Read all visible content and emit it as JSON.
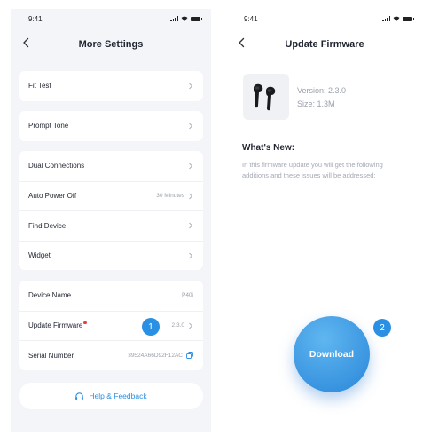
{
  "left": {
    "status_time": "9:41",
    "title": "More Settings",
    "cards": [
      {
        "rows": [
          {
            "label": "Fit Test",
            "value": ""
          }
        ]
      },
      {
        "rows": [
          {
            "label": "Prompt Tone",
            "value": ""
          }
        ]
      },
      {
        "rows": [
          {
            "label": "Dual Connections",
            "value": ""
          },
          {
            "label": "Auto Power Off",
            "value": "30 Minutes"
          },
          {
            "label": "Find Device",
            "value": ""
          },
          {
            "label": "Widget",
            "value": ""
          }
        ]
      },
      {
        "rows": [
          {
            "label": "Device Name",
            "value": "P40i"
          },
          {
            "label": "Update Firmware",
            "value": "2.3.0"
          },
          {
            "label": "Serial Number",
            "value": "39524A66D92F12AC"
          }
        ]
      }
    ],
    "help_label": "Help & Feedback",
    "badge": "1"
  },
  "right": {
    "status_time": "9:41",
    "title": "Update Firmware",
    "version": "Version: 2.3.0",
    "size": "Size: 1.3M",
    "whats_new_title": "What's New:",
    "description": "In this firmware update you will get the following additions and these issues will be addressed:",
    "download_label": "Download",
    "badge": "2"
  },
  "colors": {
    "accent": "#2a90e4",
    "alert": "#e5413a",
    "panel": "#f3f5f9"
  }
}
